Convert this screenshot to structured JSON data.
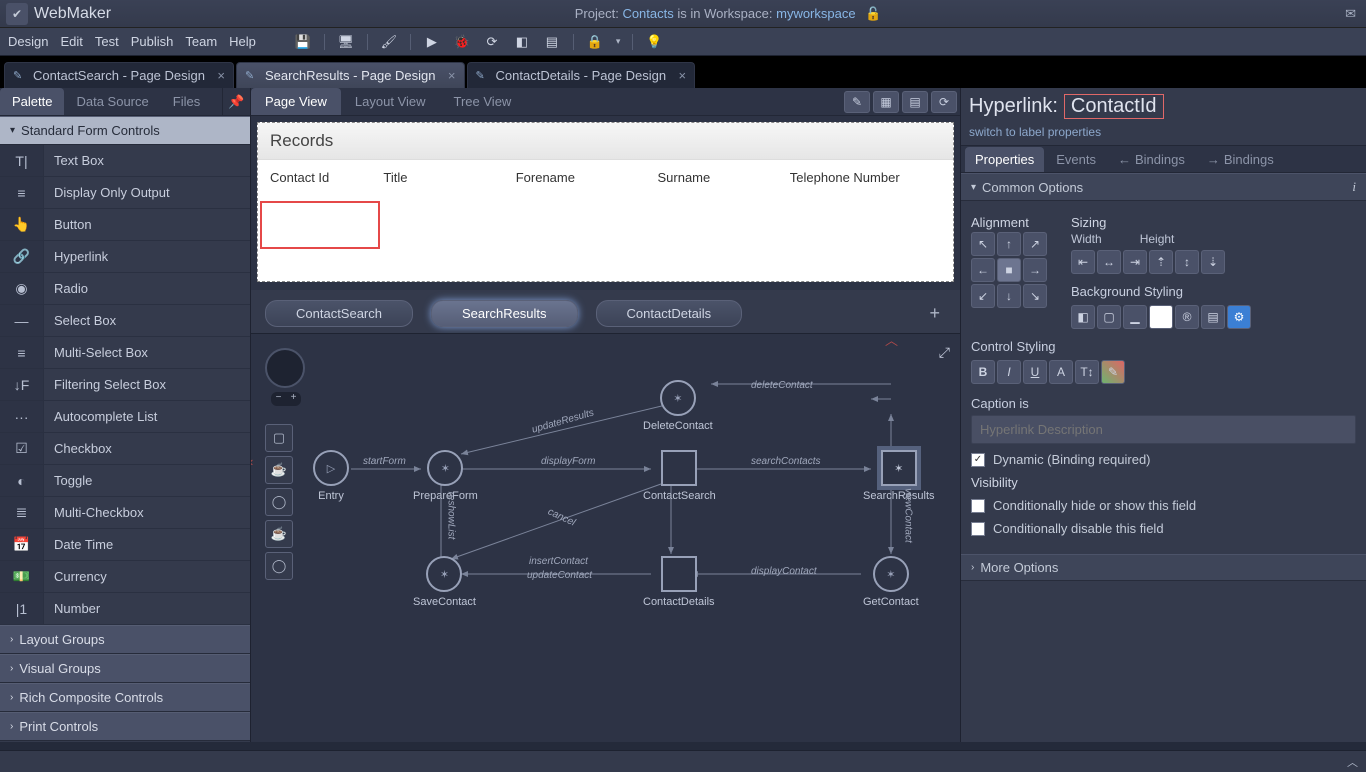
{
  "title": {
    "app": "WebMaker",
    "project_prefix": "Project: ",
    "project": "Contacts",
    "mid": " is in Workspace: ",
    "workspace": "myworkspace"
  },
  "menu": [
    "Design",
    "Edit",
    "Test",
    "Publish",
    "Team",
    "Help"
  ],
  "editor_tabs": [
    {
      "label": "ContactSearch - Page Design",
      "active": false
    },
    {
      "label": "SearchResults - Page Design",
      "active": true
    },
    {
      "label": "ContactDetails - Page Design",
      "active": false
    }
  ],
  "left_tabs": [
    "Palette",
    "Data Source",
    "Files"
  ],
  "palette": {
    "sections": [
      "Standard Form Controls",
      "Layout Groups",
      "Visual Groups",
      "Rich Composite Controls",
      "Print Controls"
    ],
    "items": [
      "Text Box",
      "Display Only Output",
      "Button",
      "Hyperlink",
      "Radio",
      "Select Box",
      "Multi-Select Box",
      "Filtering Select Box",
      "Autocomplete List",
      "Checkbox",
      "Toggle",
      "Multi-Checkbox",
      "Date Time",
      "Currency",
      "Number"
    ],
    "icons": [
      "T|",
      "≡",
      "👆",
      "🔗",
      "◉",
      "—",
      "≡",
      "↓F",
      "···",
      "☑",
      "◐",
      "≣",
      "📅",
      "💵",
      "|1"
    ]
  },
  "center_tabs": [
    "Page View",
    "Layout View",
    "Tree View"
  ],
  "records": {
    "title": "Records",
    "cols": [
      "Contact Id",
      "Title",
      "Forename",
      "Surname",
      "Telephone Number"
    ]
  },
  "flow_pills": [
    "ContactSearch",
    "SearchResults",
    "ContactDetails"
  ],
  "nodes": {
    "entry": "Entry",
    "prepare": "PrepareForm",
    "search": "ContactSearch",
    "results": "SearchResults",
    "delete": "DeleteContact",
    "save": "SaveContact",
    "details": "ContactDetails",
    "get": "GetContact"
  },
  "edges": {
    "startForm": "startForm",
    "displayForm": "displayForm",
    "searchContacts": "searchContacts",
    "deleteContact": "deleteContact",
    "updateResults": "updateResults",
    "reshowList": "reshowList",
    "cancel": "cancel",
    "insertContact": "insertContact",
    "updateContact": "updateContact",
    "displayContact": "displayContact",
    "viewContact": "viewContact"
  },
  "right": {
    "type": "Hyperlink:",
    "name": "ContactId",
    "switch": "switch to label properties",
    "tabs": [
      "Properties",
      "Events",
      "Bindings",
      "Bindings"
    ],
    "group1": "Common Options",
    "align": "Alignment",
    "sizing": "Sizing",
    "width": "Width",
    "height": "Height",
    "bgstyle": "Background Styling",
    "cstyle": "Control Styling",
    "caption": "Caption is",
    "caption_ph": "Hyperlink Description",
    "dynamic": "Dynamic (Binding required)",
    "visibility": "Visibility",
    "cond_hide": "Conditionally hide or show this field",
    "cond_disable": "Conditionally disable this field",
    "more": "More Options"
  }
}
